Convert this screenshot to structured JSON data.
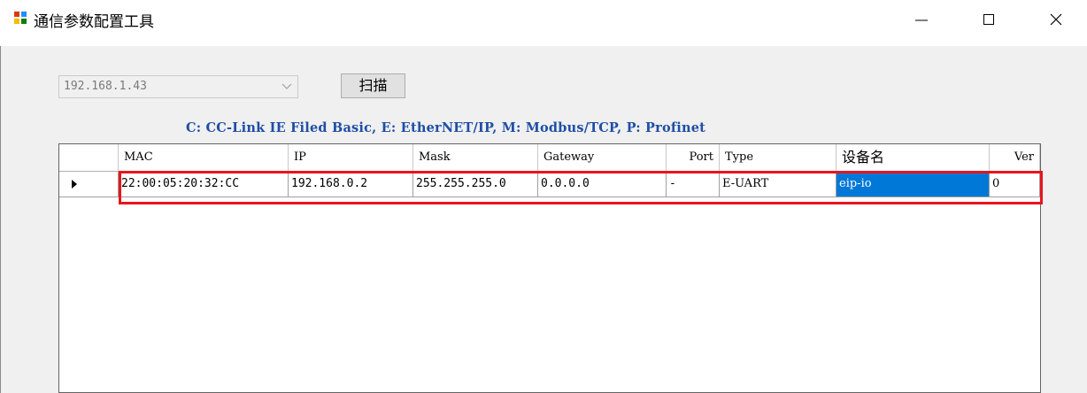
{
  "window": {
    "title": "通信参数配置工具",
    "icon": "app-grid-icon",
    "controls": [
      "minimize-icon",
      "maximize-icon",
      "close-icon"
    ]
  },
  "toolbar": {
    "ip_select": {
      "value": "192.168.1.43",
      "disabled": true
    },
    "scan_label": "扫描"
  },
  "legend": "C: CC-Link IE Filed Basic, E: EtherNET/IP, M: Modbus/TCP, P: Profinet",
  "table": {
    "columns": [
      "MAC",
      "IP",
      "Mask",
      "Gateway",
      "Port",
      "Type",
      "设备名",
      "Ver"
    ],
    "rows": [
      {
        "current": true,
        "cells": [
          "22:00:05:20:32:CC",
          "192.168.0.2",
          "255.255.255.0",
          "0.0.0.0",
          "-",
          "E-UART",
          "eip-io",
          "0"
        ],
        "selected_column": "设备名",
        "highlighted": true
      }
    ]
  },
  "colors": {
    "legend_text": "#1f4ea5",
    "selection": "#0078d7",
    "highlight_border": "#e8141e",
    "client_background": "#f0f0f0"
  }
}
